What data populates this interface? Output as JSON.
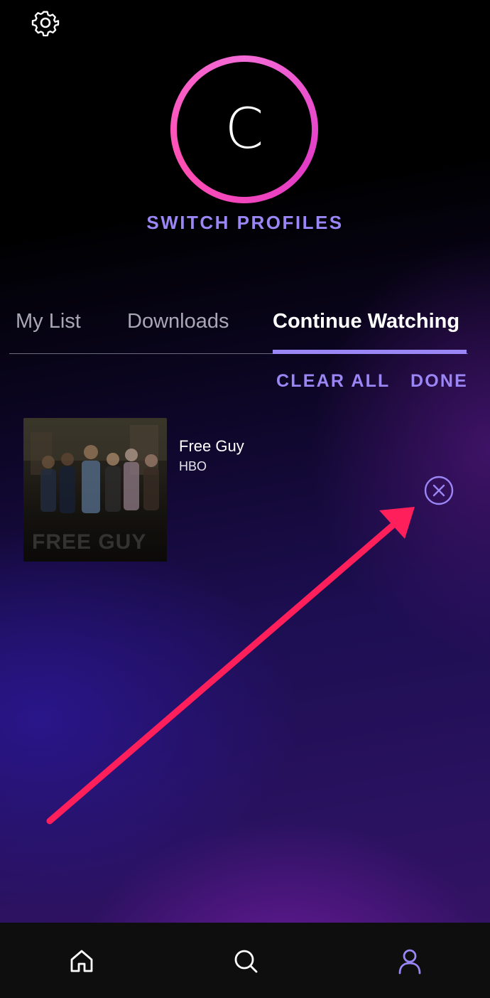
{
  "profile": {
    "initial": "C",
    "switch_label": "SWITCH PROFILES"
  },
  "tabs": [
    {
      "label": "My List",
      "active": false
    },
    {
      "label": "Downloads",
      "active": false
    },
    {
      "label": "Continue Watching",
      "active": true
    }
  ],
  "actions": {
    "clear_all": "CLEAR ALL",
    "done": "DONE"
  },
  "items": [
    {
      "title": "Free Guy",
      "network": "HBO",
      "poster_text": "FREE GUY"
    }
  ],
  "bottom_nav": [
    {
      "icon": "home-icon"
    },
    {
      "icon": "search-icon"
    },
    {
      "icon": "profile-icon",
      "active": true
    }
  ],
  "colors": {
    "accent": "#9b86f5",
    "avatar_ring": "#e23cc6",
    "annotation_arrow": "#ff1f5a",
    "nav_bar": "#0e0e0e"
  }
}
